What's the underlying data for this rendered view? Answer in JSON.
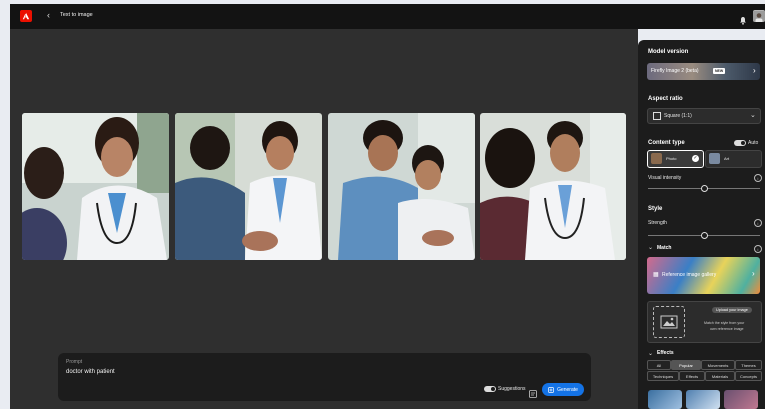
{
  "header": {
    "back_icon": "chevron-left-icon",
    "breadcrumb": "Text to image"
  },
  "images": [
    {
      "alt_icon": "photo-doctor-patient-1"
    },
    {
      "alt_icon": "photo-doctor-patient-2"
    },
    {
      "alt_icon": "photo-doctor-patient-3"
    },
    {
      "alt_icon": "photo-doctor-patient-4"
    }
  ],
  "prompt": {
    "label": "Prompt",
    "value": "doctor with patient",
    "suggestions_label": "Suggestions",
    "generate_label": "Generate"
  },
  "panel": {
    "model_version": {
      "heading": "Model version",
      "selected": "Firefly Image 2 (beta)",
      "badge": "NEW"
    },
    "aspect_ratio": {
      "heading": "Aspect ratio",
      "selected": "Square (1:1)"
    },
    "content_type": {
      "heading": "Content type",
      "auto_label": "Auto",
      "options": [
        {
          "label": "Photo",
          "selected": true
        },
        {
          "label": "Art",
          "selected": false
        }
      ],
      "visual_intensity_label": "Visual intensity",
      "visual_intensity_value": 0.5
    },
    "style": {
      "heading": "Style",
      "strength_label": "Strength",
      "strength_value": 0.5
    },
    "match": {
      "heading": "Match",
      "gallery_label": "Reference image gallery",
      "upload_label": "Upload your image",
      "upload_desc_1": "Match the style from your",
      "upload_desc_2": "own reference image"
    },
    "effects": {
      "heading": "Effects",
      "tabs_row1": [
        "All",
        "Popular",
        "Movements",
        "Themes"
      ],
      "tabs_row2": [
        "Techniques",
        "Effects",
        "Materials",
        "Concepts"
      ],
      "active_tab": "Popular"
    }
  },
  "colors": {
    "accent": "#1473e6",
    "brand": "#eb1000",
    "panel": "#1c1c1c",
    "canvas": "#2f2f2f"
  }
}
